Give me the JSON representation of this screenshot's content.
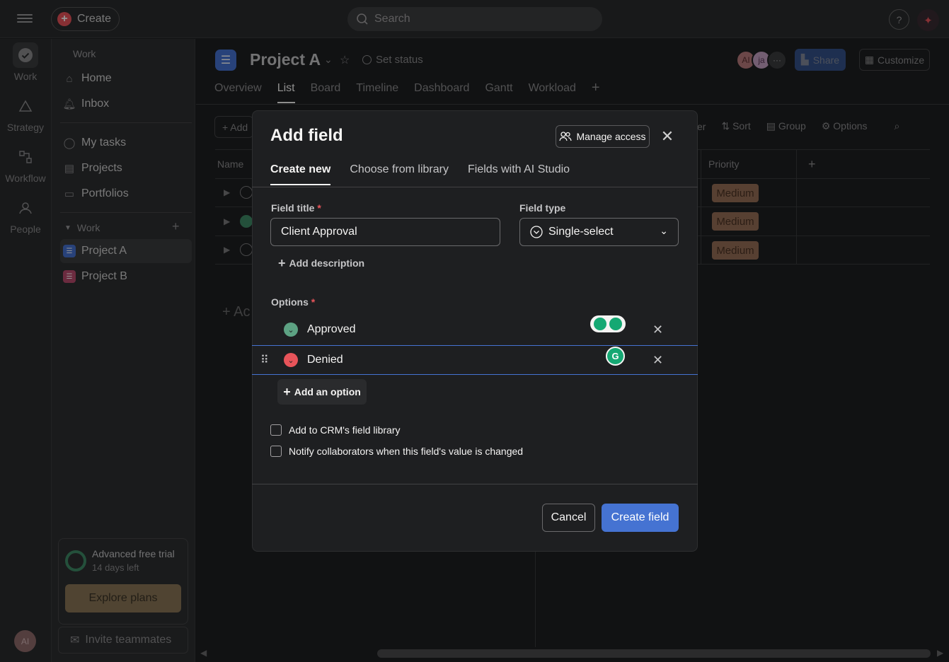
{
  "topbar": {
    "create_label": "Create",
    "search_placeholder": "Search",
    "help_label": "?"
  },
  "rail": {
    "items": [
      {
        "label": "Work",
        "icon": "check-icon"
      },
      {
        "label": "Strategy",
        "icon": "triangle-icon"
      },
      {
        "label": "Workflow",
        "icon": "workflow-icon"
      },
      {
        "label": "People",
        "icon": "people-icon"
      }
    ],
    "avatar_initials": "AI"
  },
  "sidebar": {
    "section_work": "Work",
    "home": "Home",
    "inbox": "Inbox",
    "my_tasks": "My tasks",
    "projects": "Projects",
    "portfolios": "Portfolios",
    "group_work": "Work",
    "project_a": "Project A",
    "project_b": "Project B",
    "trial_title": "Advanced free trial",
    "trial_days": "14 days left",
    "explore_plans": "Explore plans",
    "invite": "Invite teammates"
  },
  "project": {
    "title": "Project A",
    "set_status": "Set status",
    "tabs": [
      "Overview",
      "List",
      "Board",
      "Timeline",
      "Dashboard",
      "Gantt",
      "Workload"
    ],
    "active_tab": "List",
    "avatars": [
      "AI",
      "ja"
    ],
    "share": "Share",
    "customize": "Customize",
    "add_task": "+ Add",
    "toolbar": {
      "filter": "er",
      "sort": "Sort",
      "group": "Group",
      "options": "Options"
    },
    "columns": {
      "name": "Name",
      "priority": "Priority"
    },
    "priority_values": [
      "Medium",
      "Medium",
      "Medium"
    ],
    "add_section": "+ Ac"
  },
  "modal": {
    "title": "Add field",
    "manage_access": "Manage access",
    "tabs": [
      "Create new",
      "Choose from library",
      "Fields with AI Studio"
    ],
    "active_tab": "Create new",
    "field_title_label": "Field title",
    "field_title_value": "Client Approval",
    "field_type_label": "Field type",
    "field_type_value": "Single-select",
    "add_description": "Add description",
    "options_label": "Options",
    "options": [
      {
        "label": "Approved",
        "color": "#5da283"
      },
      {
        "label": "Denied",
        "color": "#e8545a"
      }
    ],
    "add_option": "Add an option",
    "checkbox_crm": "Add to CRM's field library",
    "checkbox_notify": "Notify collaborators when this field's value is changed",
    "cancel": "Cancel",
    "create_field": "Create field"
  },
  "colors": {
    "accent": "#4573d2",
    "danger": "#e8545a",
    "success": "#5da283",
    "priority_medium": "#c08a6a"
  }
}
